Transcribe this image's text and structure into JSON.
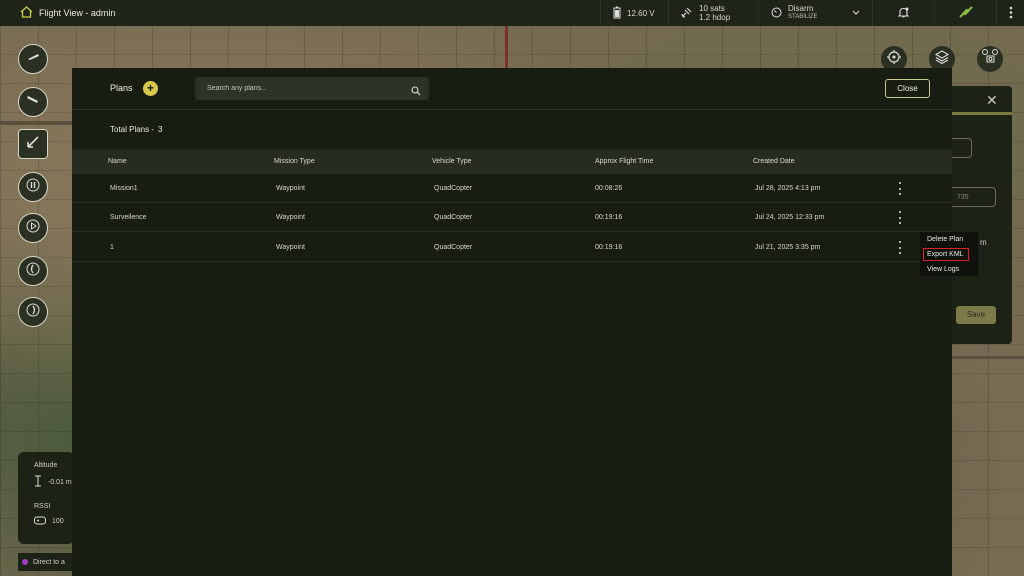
{
  "app": {
    "title": "Flight View - admin",
    "icons": {
      "home": "home-icon",
      "battery": "battery-icon",
      "satellite": "satellite-icon",
      "mode": "gauge-icon",
      "bell": "bell-icon",
      "link": "drone-link-icon",
      "menu": "more-vertical-icon"
    }
  },
  "status": {
    "battery": "12.60 V",
    "sats": "10 sats",
    "hdop": "1.2 hdop",
    "arm_state": "Disarm",
    "flight_mode": "STABILIZE"
  },
  "side_panel": {
    "field_value": "735",
    "unit": "m",
    "save_label": "Save"
  },
  "telemetry": {
    "altitude_label": "Altitude",
    "altitude_value": "-0.01 m",
    "rssi_label": "RSSI",
    "rssi_value": "100"
  },
  "footer_hint": "Direct to a",
  "modal": {
    "title": "Plans",
    "add_symbol": "+",
    "search_placeholder": "Search any plans...",
    "close_label": "Close",
    "total_label": "Total Plans -",
    "total_count": "3",
    "columns": [
      "Name",
      "Mission Type",
      "Vehicle Type",
      "Approx Flight Time",
      "Created Date"
    ],
    "rows": [
      {
        "name": "Mission1",
        "mission_type": "Waypoint",
        "vehicle_type": "QuadCopter",
        "flight_time": "00:08:26",
        "created": "Jul 28, 2025  4:13 pm"
      },
      {
        "name": "Surveilence",
        "mission_type": "Waypoint",
        "vehicle_type": "QuadCopter",
        "flight_time": "00:19:16",
        "created": "Jul 24, 2025  12:33 pm"
      },
      {
        "name": "1",
        "mission_type": "Waypoint",
        "vehicle_type": "QuadCopter",
        "flight_time": "00:19:16",
        "created": "Jul 21, 2025  3:35 pm"
      }
    ]
  },
  "context_menu": {
    "items": [
      "Delete Plan",
      "Export KML",
      "View Logs"
    ],
    "highlighted": "Export KML"
  },
  "colors": {
    "accent": "#d8c84a",
    "highlight": "#e02020",
    "panel": "#171d13"
  }
}
